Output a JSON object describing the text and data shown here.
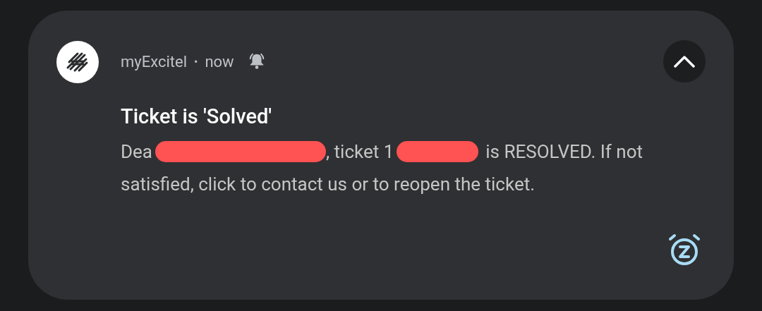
{
  "notification": {
    "app_name": "myExcitel",
    "separator": "•",
    "time": "now",
    "alerting": true,
    "expanded": true,
    "title": "Ticket is 'Solved'",
    "body": [
      {
        "kind": "text",
        "text": "Dea"
      },
      {
        "kind": "redaction",
        "color": "#ff5252"
      },
      {
        "kind": "text",
        "text": ", ticket 1"
      },
      {
        "kind": "redaction",
        "color": "#ff5252"
      },
      {
        "kind": "text",
        "text": "is RESOLVED. If not"
      },
      {
        "kind": "text",
        "text": "satisfied, click to contact us or to reopen the ticket."
      }
    ]
  }
}
